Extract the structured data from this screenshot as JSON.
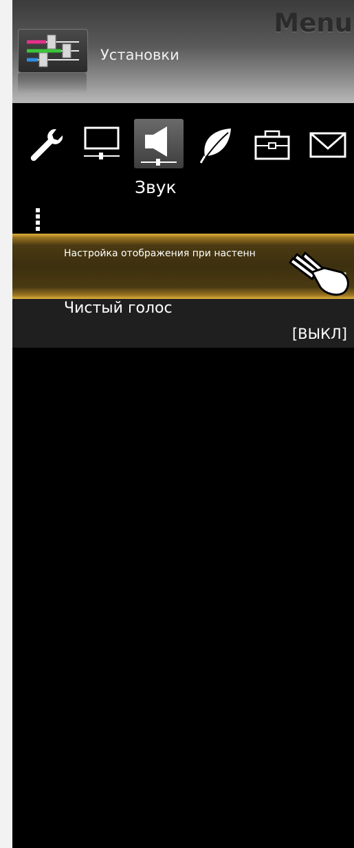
{
  "header": {
    "title": "Menu",
    "section_label": "Установки"
  },
  "categories": {
    "icons": [
      "wrench-icon",
      "monitor-icon",
      "speaker-icon",
      "leaf-icon",
      "toolbox-icon",
      "envelope-icon"
    ],
    "selected_label": "Звук"
  },
  "menu_items": [
    {
      "label": "Настройка отображения при настенн",
      "value": "]"
    },
    {
      "label": "Чистый голос",
      "value": "[ВЫКЛ]"
    }
  ],
  "colors": {
    "highlight": "#c9982c",
    "background": "#000000",
    "header": "#5a5a5a"
  }
}
